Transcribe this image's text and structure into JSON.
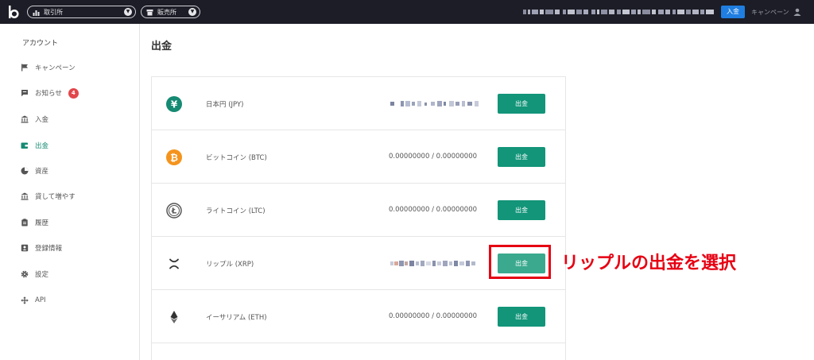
{
  "topbar": {
    "exchange_label": "取引所",
    "sales_label": "販売所",
    "deposit_label": "入金",
    "campaign_label": "キャンペーン"
  },
  "sidebar": {
    "heading": "アカウント",
    "items": [
      {
        "label": "キャンペーン",
        "icon": "flag-icon"
      },
      {
        "label": "お知らせ",
        "icon": "message-icon",
        "badge": "4"
      },
      {
        "label": "入金",
        "icon": "bank-icon"
      },
      {
        "label": "出金",
        "icon": "wallet-icon",
        "active": true
      },
      {
        "label": "資産",
        "icon": "pie-chart-icon"
      },
      {
        "label": "貸して増やす",
        "icon": "bank-icon"
      },
      {
        "label": "履歴",
        "icon": "clipboard-icon"
      },
      {
        "label": "登録情報",
        "icon": "id-card-icon"
      },
      {
        "label": "設定",
        "icon": "gear-icon"
      },
      {
        "label": "API",
        "icon": "api-icon"
      }
    ]
  },
  "main": {
    "title": "出金",
    "rows": [
      {
        "name": "日本円 (JPY)",
        "balance": "",
        "button": "出金",
        "icon": "yen-icon"
      },
      {
        "name": "ビットコイン (BTC)",
        "balance": "0.00000000 / 0.00000000",
        "button": "出金",
        "icon": "bitcoin-icon"
      },
      {
        "name": "ライトコイン (LTC)",
        "balance": "0.00000000 / 0.00000000",
        "button": "出金",
        "icon": "litecoin-icon"
      },
      {
        "name": "リップル (XRP)",
        "balance": "",
        "button": "出金",
        "icon": "ripple-icon"
      },
      {
        "name": "イーサリアム (ETH)",
        "balance": "0.00000000 / 0.00000000",
        "button": "出金",
        "icon": "ethereum-icon"
      }
    ]
  },
  "annotation": {
    "text": "リップルの出金を選択",
    "color": "#e60012"
  },
  "colors": {
    "accent": "#129579",
    "deposit": "#1f7ee0",
    "badge": "#e2474b",
    "topbar": "#1c1d26"
  }
}
